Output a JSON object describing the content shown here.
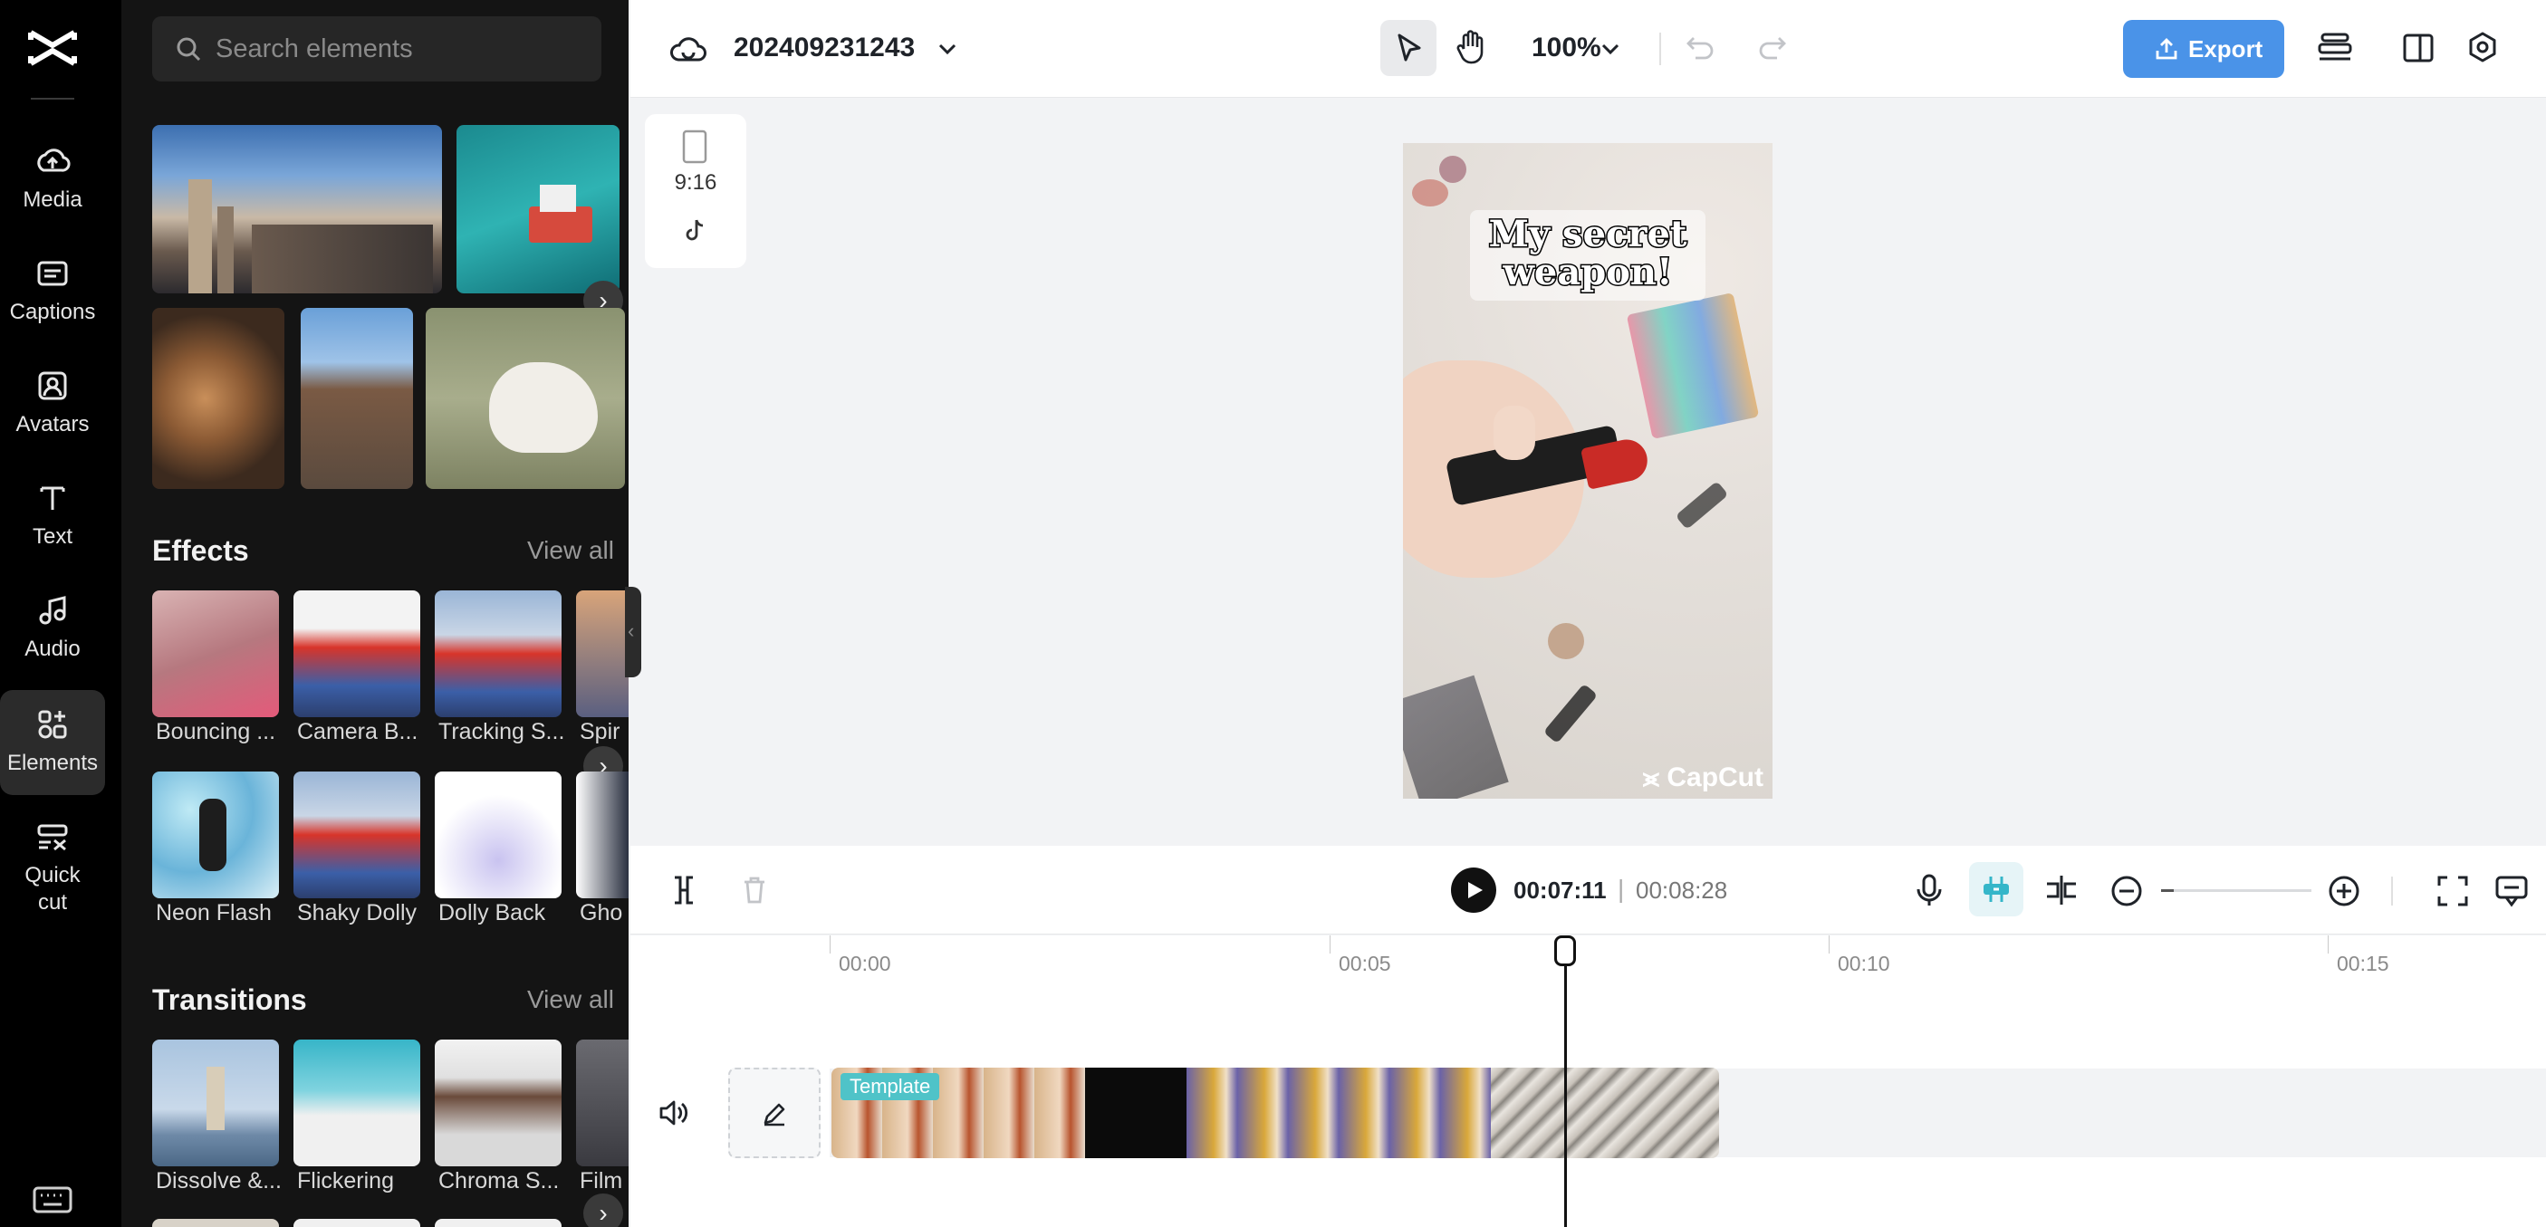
{
  "rail": {
    "items": [
      {
        "label": "Media",
        "icon": "cloud-upload-icon"
      },
      {
        "label": "Captions",
        "icon": "captions-icon"
      },
      {
        "label": "Avatars",
        "icon": "avatar-icon"
      },
      {
        "label": "Text",
        "icon": "text-icon"
      },
      {
        "label": "Audio",
        "icon": "music-note-icon"
      },
      {
        "label": "Elements",
        "icon": "elements-icon"
      },
      {
        "label": "Quick",
        "label2": "cut",
        "icon": "quick-cut-icon"
      }
    ],
    "active": "Elements"
  },
  "panel": {
    "search_placeholder": "Search elements",
    "effects": {
      "title": "Effects",
      "view_all": "View all",
      "items": [
        "Bouncing ...",
        "Camera B...",
        "Tracking S...",
        "Spir",
        "Neon Flash",
        "Shaky Dolly",
        "Dolly Back",
        "Gho"
      ]
    },
    "transitions": {
      "title": "Transitions",
      "view_all": "View all",
      "items": [
        "Dissolve &...",
        "Flickering",
        "Chroma S...",
        "Film"
      ]
    }
  },
  "topbar": {
    "project_name": "202409231243",
    "zoom": "100%",
    "export_label": "Export"
  },
  "canvas": {
    "ratio_label": "9:16",
    "caption_line1": "My secret",
    "caption_line2": "weapon!",
    "watermark": "CapCut"
  },
  "timeline": {
    "current_time": "00:07:11",
    "separator": "|",
    "total_time": "00:08:28",
    "ruler": [
      "00:00",
      "00:05",
      "00:10",
      "00:15"
    ],
    "clip_badge": "Template",
    "playhead_position_seconds": 7.37
  },
  "colors": {
    "accent": "#4a93e8",
    "rail_bg": "#000000",
    "panel_bg": "#141414",
    "template_badge": "#4fc3c8"
  }
}
